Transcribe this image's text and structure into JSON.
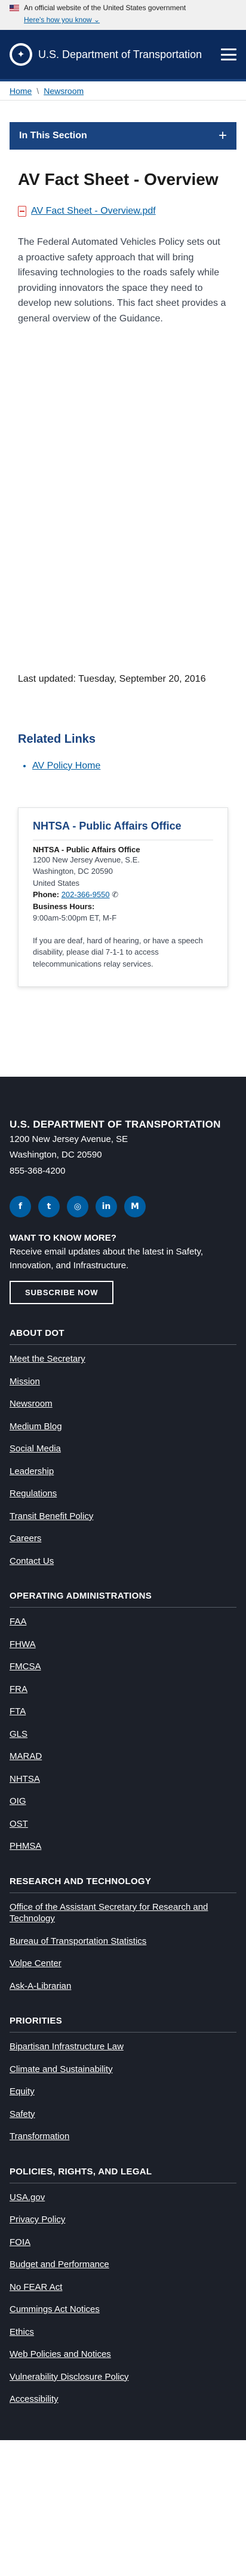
{
  "gov_banner": {
    "text": "An official website of the United States government",
    "howknow": "Here's how you know"
  },
  "header": {
    "title": "U.S. Department of Transportation"
  },
  "breadcrumb": {
    "items": [
      "Home",
      "Newsroom"
    ]
  },
  "in_section": {
    "label": "In This Section"
  },
  "page": {
    "title": "AV Fact Sheet - Overview",
    "pdf_link": "AV Fact Sheet - Overview.pdf",
    "body": "The Federal Automated Vehicles Policy sets out a proactive safety approach that will bring lifesaving technologies to the roads safely while providing innovators the space they need to develop new solutions. This fact sheet provides a general overview of the Guidance.",
    "last_updated": "Last updated: Tuesday, September 20, 2016"
  },
  "related": {
    "title": "Related Links",
    "items": [
      "AV Policy Home"
    ]
  },
  "contact": {
    "title": "NHTSA - Public Affairs Office",
    "org": "NHTSA - Public Affairs Office",
    "address1": "1200 New Jersey Avenue, S.E.",
    "address2": "Washington, DC 20590",
    "country": "United States",
    "phone_label": "Phone:",
    "phone": "202-366-9550",
    "hours_label": "Business Hours:",
    "hours": "9:00am-5:00pm ET, M-F",
    "deaf_note": "If you are deaf, hard of hearing, or have a speech disability, please dial 7-1-1 to access telecommunications relay services."
  },
  "footer": {
    "name": "U.S. DEPARTMENT OF TRANSPORTATION",
    "address1": "1200 New Jersey Avenue, SE",
    "address2": "Washington, DC 20590",
    "phone": "855-368-4200",
    "socials": [
      {
        "icon": "facebook-icon",
        "glyph": "f"
      },
      {
        "icon": "twitter-icon",
        "glyph": "t"
      },
      {
        "icon": "instagram-icon",
        "glyph": "◎"
      },
      {
        "icon": "linkedin-icon",
        "glyph": "in"
      },
      {
        "icon": "medium-icon",
        "glyph": "M"
      }
    ],
    "want_title": "WANT TO KNOW MORE?",
    "want_sub": "Receive email updates about the latest in Safety, Innovation, and Infrastructure.",
    "subscribe": "SUBSCRIBE NOW",
    "sections": [
      {
        "title": "ABOUT DOT",
        "items": [
          "Meet the Secretary",
          "Mission",
          "Newsroom",
          "Medium Blog",
          "Social Media",
          "Leadership",
          "Regulations",
          "Transit Benefit Policy",
          "Careers",
          "Contact Us"
        ]
      },
      {
        "title": "OPERATING ADMINISTRATIONS",
        "items": [
          "FAA",
          "FHWA",
          "FMCSA",
          "FRA",
          "FTA",
          "GLS",
          "MARAD",
          "NHTSA",
          "OIG",
          "OST",
          "PHMSA"
        ]
      },
      {
        "title": "RESEARCH AND TECHNOLOGY",
        "items": [
          "Office of the Assistant Secretary for Research and Technology",
          "Bureau of Transportation Statistics",
          "Volpe Center",
          "Ask-A-Librarian"
        ]
      },
      {
        "title": "PRIORITIES",
        "items": [
          "Bipartisan Infrastructure Law",
          "Climate and Sustainability",
          "Equity",
          "Safety",
          "Transformation"
        ]
      },
      {
        "title": "POLICIES, RIGHTS, AND LEGAL",
        "items": [
          "USA.gov",
          "Privacy Policy",
          "FOIA",
          "Budget and Performance",
          "No FEAR Act",
          "Cummings Act Notices",
          "Ethics",
          "Web Policies and Notices",
          "Vulnerability Disclosure Policy",
          "Accessibility"
        ]
      }
    ]
  },
  "colors": {
    "header_bg": "#0b2a5c",
    "section_bar": "#1a4480",
    "link": "#005ea2",
    "footer_bg": "#1c2029"
  }
}
